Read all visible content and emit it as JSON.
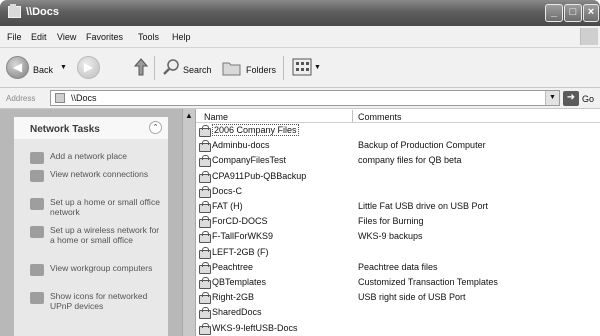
{
  "window": {
    "title": "\\\\Docs",
    "buttons": {
      "minimize": "_",
      "maximize": "□",
      "close": "×"
    }
  },
  "menu": [
    "File",
    "Edit",
    "View",
    "Favorites",
    "Tools",
    "Help"
  ],
  "toolbar": {
    "back": "Back",
    "search": "Search",
    "folders": "Folders"
  },
  "address": {
    "label": "Address",
    "value": "\\\\Docs",
    "go": "Go"
  },
  "tasks": {
    "title": "Network Tasks",
    "items": [
      {
        "label": "Add a network place",
        "icon": "network-place-icon"
      },
      {
        "label": "View network connections",
        "icon": "network-connections-icon"
      },
      {
        "label": "Set up a home or small office network",
        "icon": "home-network-icon"
      },
      {
        "label": "Set up a wireless network for a home or small office",
        "icon": "wireless-network-icon"
      },
      {
        "label": "View workgroup computers",
        "icon": "workgroup-icon"
      },
      {
        "label": "Show icons for networked UPnP devices",
        "icon": "upnp-icon"
      }
    ]
  },
  "list": {
    "columns": {
      "name": "Name",
      "comments": "Comments"
    },
    "rows": [
      {
        "name": "2006 Company Files",
        "comment": ""
      },
      {
        "name": "Adminbu-docs",
        "comment": "Backup of Production Computer"
      },
      {
        "name": "CompanyFilesTest",
        "comment": "company files for QB beta"
      },
      {
        "name": "CPA911Pub-QBBackup",
        "comment": ""
      },
      {
        "name": "Docs-C",
        "comment": ""
      },
      {
        "name": "FAT (H)",
        "comment": "Little Fat USB drive on USB Port"
      },
      {
        "name": "ForCD-DOCS",
        "comment": "Files for Burning"
      },
      {
        "name": "F-TallForWKS9",
        "comment": "WKS-9 backups"
      },
      {
        "name": "LEFT-2GB (F)",
        "comment": ""
      },
      {
        "name": "Peachtree",
        "comment": "Peachtree data files"
      },
      {
        "name": "QBTemplates",
        "comment": "Customized Transaction Templates"
      },
      {
        "name": "Right-2GB",
        "comment": "USB right side of USB Port"
      },
      {
        "name": "SharedDocs",
        "comment": ""
      },
      {
        "name": "WKS-9-leftUSB-Docs",
        "comment": ""
      }
    ]
  }
}
